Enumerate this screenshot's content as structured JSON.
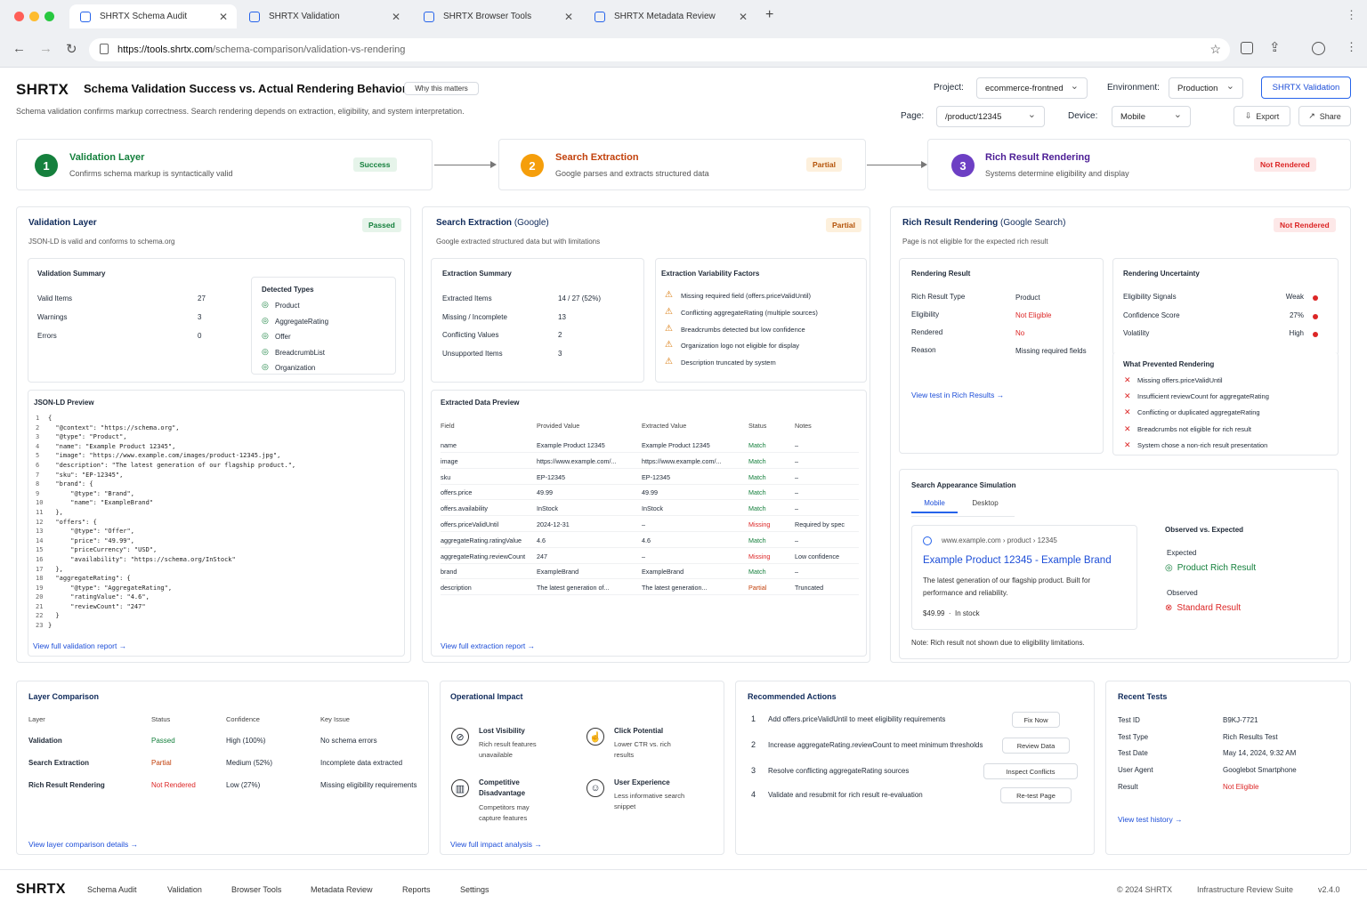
{
  "browser": {
    "tabs": [
      "SHRTX Schema Audit",
      "SHRTX Validation",
      "SHRTX Browser Tools",
      "SHRTX Metadata Review"
    ],
    "url_domain": "https://tools.shrtx.com",
    "url_path": "/schema-comparison/validation-vs-rendering"
  },
  "header": {
    "brand": "SHRTX",
    "title": "Schema Validation Success vs. Actual Rendering Behavior",
    "why": "Why this matters",
    "subtitle": "Schema validation confirms markup correctness. Search rendering depends on extraction, eligibility, and system interpretation.",
    "project_label": "Project:",
    "project_value": "ecommerce-frontned",
    "env_label": "Environment:",
    "env_value": "Production",
    "validation_btn": "SHRTX Validation",
    "page_label": "Page:",
    "page_value": "/product/12345",
    "device_label": "Device:",
    "device_value": "Mobile",
    "export": "Export",
    "share": "Share"
  },
  "steps": [
    {
      "num": "1",
      "title": "Validation Layer",
      "desc": "Confirms schema markup is syntactically valid",
      "badge": "Success",
      "color": "#15803d"
    },
    {
      "num": "2",
      "title": "Search Extraction",
      "desc": "Google parses and extracts structured data",
      "badge": "Partial",
      "color": "#f59e0b"
    },
    {
      "num": "3",
      "title": "Rich Result Rendering",
      "desc": "Systems determine eligibility and display",
      "badge": "Not Rendered",
      "color": "#6d3fc4"
    }
  ],
  "validation": {
    "title": "Validation Layer",
    "badge": "Passed",
    "desc": "JSON-LD is valid and conforms to schema.org",
    "summary_title": "Validation Summary",
    "summary": [
      {
        "k": "Valid Items",
        "v": "27"
      },
      {
        "k": "Warnings",
        "v": "3"
      },
      {
        "k": "Errors",
        "v": "0"
      }
    ],
    "types_title": "Detected Types",
    "types": [
      "Product",
      "AggregateRating",
      "Offer",
      "BreadcrumbList",
      "Organization"
    ],
    "json_title": "JSON-LD Preview",
    "json_lines": [
      "{",
      "  \"@context\": \"https://schema.org\",",
      "  \"@type\": \"Product\",",
      "  \"name\": \"Example Product 12345\",",
      "  \"image\": \"https://www.example.com/images/product-12345.jpg\",",
      "  \"description\": \"The latest generation of our flagship product.\",",
      "  \"sku\": \"EP-12345\",",
      "  \"brand\": {",
      "      \"@type\": \"Brand\",",
      "      \"name\": \"ExampleBrand\"",
      "  },",
      "  \"offers\": {",
      "      \"@type\": \"Offer\",",
      "      \"price\": \"49.99\",",
      "      \"priceCurrency\": \"USD\",",
      "      \"availability\": \"https://schema.org/InStock\"",
      "  },",
      "  \"aggregateRating\": {",
      "      \"@type\": \"AggregateRating\",",
      "      \"ratingValue\": \"4.6\",",
      "      \"reviewCount\": \"247\"",
      "  }",
      "}"
    ],
    "line_nums": [
      "1",
      "2",
      "3",
      "4",
      "5",
      "6",
      "7",
      "8",
      "9",
      "10",
      "11",
      "12",
      "13",
      "14",
      "15",
      "16",
      "17",
      "18",
      "19",
      "20",
      "21",
      "22",
      "23"
    ],
    "link": "View full validation report"
  },
  "extraction": {
    "title": "Search Extraction",
    "title2": " (Google)",
    "badge": "Partial",
    "desc": "Google extracted structured data but with limitations",
    "summary_title": "Extraction Summary",
    "summary": [
      {
        "k": "Extracted Items",
        "v": "14 / 27 (52%)"
      },
      {
        "k": "Missing / Incomplete",
        "v": "13"
      },
      {
        "k": "Conflicting Values",
        "v": "2"
      },
      {
        "k": "Unsupported Items",
        "v": "3"
      }
    ],
    "factors_title": "Extraction Variability Factors",
    "factors": [
      "Missing required field (offers.priceValidUntil)",
      "Conflicting aggregateRating (multiple sources)",
      "Breadcrumbs detected but low confidence",
      "Organization logo not eligible for display",
      "Description truncated by system"
    ],
    "preview_title": "Extracted Data Preview",
    "cols": [
      "Field",
      "Provided Value",
      "Extracted Value",
      "Status",
      "Notes"
    ],
    "rows": [
      [
        "name",
        "Example Product 12345",
        "Example Product 12345",
        "Match",
        "–"
      ],
      [
        "image",
        "https://www.example.com/...",
        "https://www.example.com/...",
        "Match",
        "–"
      ],
      [
        "sku",
        "EP-12345",
        "EP-12345",
        "Match",
        "–"
      ],
      [
        "offers.price",
        "49.99",
        "49.99",
        "Match",
        "–"
      ],
      [
        "offers.availability",
        "InStock",
        "InStock",
        "Match",
        "–"
      ],
      [
        "offers.priceValidUntil",
        "2024-12-31",
        "–",
        "Missing",
        "Required by spec"
      ],
      [
        "aggregateRating.ratingValue",
        "4.6",
        "4.6",
        "Match",
        "–"
      ],
      [
        "aggregateRating.reviewCount",
        "247",
        "–",
        "Missing",
        "Low confidence"
      ],
      [
        "brand",
        "ExampleBrand",
        "ExampleBrand",
        "Match",
        "–"
      ],
      [
        "description",
        "The latest generation of...",
        "The latest generation...",
        "Partial",
        "Truncated"
      ]
    ],
    "link": "View full extraction report"
  },
  "rendering": {
    "title": "Rich Result Rendering",
    "title2": " (Google Search)",
    "badge": "Not Rendered",
    "desc": "Page is not eligible for the expected rich result",
    "result_title": "Rendering Result",
    "result": [
      {
        "k": "Rich Result Type",
        "v": "Product"
      },
      {
        "k": "Eligibility",
        "v": "Not Eligible"
      },
      {
        "k": "Rendered",
        "v": "No"
      },
      {
        "k": "Reason",
        "v": "Missing required fields"
      }
    ],
    "result_link": "View test in Rich Results",
    "uncert_title": "Rendering Uncertainty",
    "uncert": [
      {
        "k": "Eligibility Signals",
        "v": "Weak"
      },
      {
        "k": "Confidence Score",
        "v": "27%"
      },
      {
        "k": "Volatility",
        "v": "High"
      }
    ],
    "prevented_title": "What Prevented Rendering",
    "prevented": [
      "Missing offers.priceValidUntil",
      "Insufficient reviewCount for aggregateRating",
      "Conflicting or duplicated aggregateRating",
      "Breadcrumbs not eligible for rich result",
      "System chose a non-rich result presentation"
    ],
    "sim_title": "Search Appearance Simulation",
    "sim_tabs": [
      "Mobile",
      "Desktop"
    ],
    "serp_url": "www.example.com › product › 12345",
    "serp_title": "Example Product 12345 - Example Brand",
    "serp_desc": "The latest generation of our flagship product. Built for performance and reliability.",
    "serp_meta": "$49.99  ·  In stock",
    "obs_title": "Observed vs. Expected",
    "expected_label": "Expected",
    "expected_val": "Product Rich Result",
    "observed_label": "Observed",
    "observed_val": "Standard Result",
    "note": "Note: Rich result not shown due to eligibility limitations."
  },
  "layer_cmp": {
    "title": "Layer Comparison",
    "cols": [
      "Layer",
      "Status",
      "Confidence",
      "Key Issue"
    ],
    "rows": [
      [
        "Validation",
        "Passed",
        "High (100%)",
        "No schema errors"
      ],
      [
        "Search Extraction",
        "Partial",
        "Medium (52%)",
        "Incomplete data extracted"
      ],
      [
        "Rich Result Rendering",
        "Not Rendered",
        "Low (27%)",
        "Missing eligibility requirements"
      ]
    ],
    "link": "View layer comparison details"
  },
  "impact": {
    "title": "Operational Impact",
    "items": [
      {
        "t": "Lost Visibility",
        "d": "Rich result features unavailable",
        "icon": "eye-off-icon"
      },
      {
        "t": "Click Potential",
        "d": "Lower CTR vs. rich results",
        "icon": "cursor-click-icon"
      },
      {
        "t": "Competitive Disadvantage",
        "d": "Competitors may capture features",
        "icon": "bar-chart-icon"
      },
      {
        "t": "User Experience",
        "d": "Less informative search snippet",
        "icon": "user-icon"
      }
    ],
    "link": "View full impact analysis"
  },
  "actions": {
    "title": "Recommended Actions",
    "items": [
      {
        "n": "1",
        "t": "Add offers.priceValidUntil to meet eligibility requirements",
        "b": "Fix Now"
      },
      {
        "n": "2",
        "t": "Increase aggregateRating.reviewCount to meet minimum thresholds",
        "b": "Review Data"
      },
      {
        "n": "3",
        "t": "Resolve conflicting aggregateRating sources",
        "b": "Inspect Conflicts"
      },
      {
        "n": "4",
        "t": "Validate and resubmit for rich result re-evaluation",
        "b": "Re-test Page"
      }
    ]
  },
  "recent": {
    "title": "Recent Tests",
    "rows": [
      {
        "k": "Test ID",
        "v": "B9KJ-7721"
      },
      {
        "k": "Test Type",
        "v": "Rich Results Test"
      },
      {
        "k": "Test Date",
        "v": "May 14, 2024, 9:32 AM"
      },
      {
        "k": "User Agent",
        "v": "Googlebot Smartphone"
      },
      {
        "k": "Result",
        "v": "Not Eligible"
      }
    ],
    "link": "View test history"
  },
  "footer": {
    "brand": "SHRTX",
    "nav": [
      "Schema Audit",
      "Validation",
      "Browser Tools",
      "Metadata Review",
      "Reports",
      "Settings"
    ],
    "copy": "© 2024 SHRTX",
    "suite": "Infrastructure Review Suite",
    "version": "v2.4.0"
  }
}
